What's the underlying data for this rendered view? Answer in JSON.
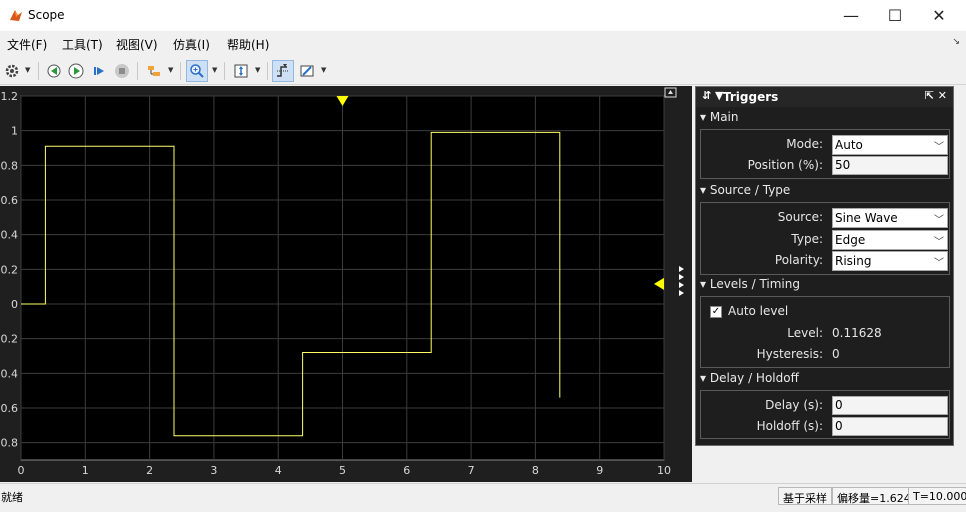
{
  "window": {
    "title": "Scope"
  },
  "window_controls": {
    "minimize": "—",
    "maximize": "☐",
    "close": "✕"
  },
  "menu": [
    "文件(F)",
    "工具(T)",
    "视图(V)",
    "仿真(I)",
    "帮助(H)"
  ],
  "toolbar": {
    "icons": [
      "gear-icon",
      "step-back-icon",
      "run-icon",
      "step-forward-icon",
      "stop-icon",
      "highlight-icon",
      "zoom-icon",
      "scale-axes-icon",
      "triggers-icon",
      "cursor-measurements-icon"
    ]
  },
  "colors": {
    "signal": "#ffff66",
    "grid": "#3c3c3c",
    "plot_bg": "#000000",
    "trigger_marker": "#ffff00"
  },
  "chart_data": {
    "type": "line",
    "title": "",
    "xlabel": "",
    "ylabel": "",
    "xlim": [
      0,
      10
    ],
    "ylim": [
      -0.9,
      1.2
    ],
    "x_ticks": [
      0,
      1,
      2,
      3,
      4,
      5,
      6,
      7,
      8,
      9,
      10
    ],
    "y_ticks": [
      1.2,
      1,
      0.8,
      0.6,
      0.4,
      0.2,
      0,
      -0.2,
      -0.4,
      -0.6,
      -0.8
    ],
    "series": [
      {
        "x": [
          0,
          0.38,
          0.38,
          2.38,
          2.38,
          4.38,
          4.38,
          6.38,
          6.38,
          8.38,
          8.38
        ],
        "y": [
          0,
          0,
          0.91,
          0.91,
          -0.76,
          -0.76,
          -0.28,
          -0.28,
          0.99,
          0.99,
          -0.54
        ]
      }
    ],
    "trigger_position_x": 5,
    "trigger_level_y": 0.11628
  },
  "triggers_panel": {
    "title": "Triggers",
    "sections": {
      "main": {
        "title": "Main",
        "mode_label": "Mode:",
        "mode_value": "Auto",
        "position_label": "Position (%):",
        "position_value": "50"
      },
      "source_type": {
        "title": "Source / Type",
        "source_label": "Source:",
        "source_value": "Sine Wave",
        "type_label": "Type:",
        "type_value": "Edge",
        "polarity_label": "Polarity:",
        "polarity_value": "Rising"
      },
      "levels_timing": {
        "title": "Levels / Timing",
        "auto_level_label": "Auto level",
        "auto_level_checked": true,
        "level_label": "Level:",
        "level_value": "0.11628",
        "hysteresis_label": "Hysteresis:",
        "hysteresis_value": "0"
      },
      "delay_holdoff": {
        "title": "Delay / Holdoff",
        "delay_label": "Delay (s):",
        "delay_value": "0",
        "holdoff_label": "Holdoff (s):",
        "holdoff_value": "0"
      }
    }
  },
  "status": {
    "left": "就绪",
    "sample_based": "基于采样",
    "offset": "偏移量=1.624",
    "time": "T=10.000"
  }
}
